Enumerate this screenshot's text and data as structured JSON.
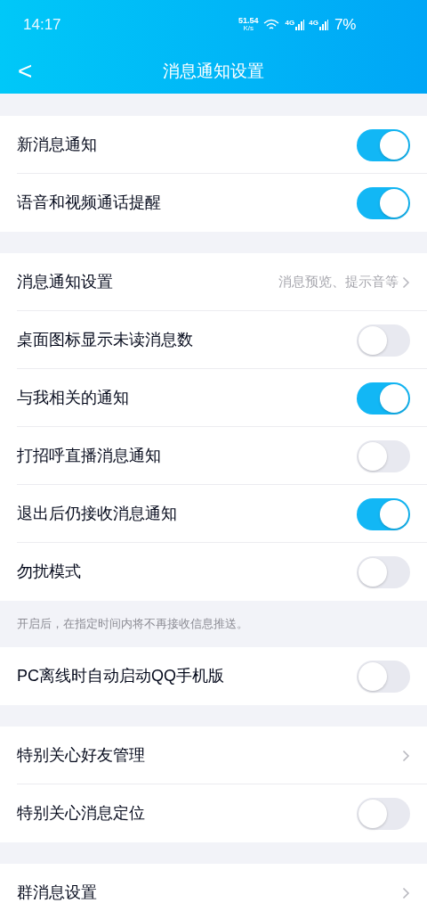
{
  "status_bar": {
    "time": "14:17",
    "speed_value": "51.54",
    "speed_unit": "K/s",
    "network_1": "4G",
    "network_2": "4G",
    "battery": "7%"
  },
  "header": {
    "back": "<",
    "title": "消息通知设置"
  },
  "groups": [
    {
      "rows": [
        {
          "kind": "toggle",
          "label": "新消息通知",
          "on": true
        },
        {
          "kind": "toggle",
          "label": "语音和视频通话提醒",
          "on": true
        }
      ]
    },
    {
      "rows": [
        {
          "kind": "link",
          "label": "消息通知设置",
          "value": "消息预览、提示音等"
        },
        {
          "kind": "toggle",
          "label": "桌面图标显示未读消息数",
          "on": false
        },
        {
          "kind": "toggle",
          "label": "与我相关的通知",
          "on": true
        },
        {
          "kind": "toggle",
          "label": "打招呼直播消息通知",
          "on": false
        },
        {
          "kind": "toggle",
          "label": "退出后仍接收消息通知",
          "on": true
        },
        {
          "kind": "toggle",
          "label": "勿扰模式",
          "on": false
        }
      ],
      "note": "开启后，在指定时间内将不再接收信息推送。"
    },
    {
      "rows": [
        {
          "kind": "toggle",
          "label": "PC离线时自动启动QQ手机版",
          "on": false
        }
      ]
    },
    {
      "rows": [
        {
          "kind": "link",
          "label": "特别关心好友管理"
        },
        {
          "kind": "toggle",
          "label": "特别关心消息定位",
          "on": false
        }
      ]
    },
    {
      "rows": [
        {
          "kind": "link",
          "label": "群消息设置"
        }
      ]
    }
  ]
}
